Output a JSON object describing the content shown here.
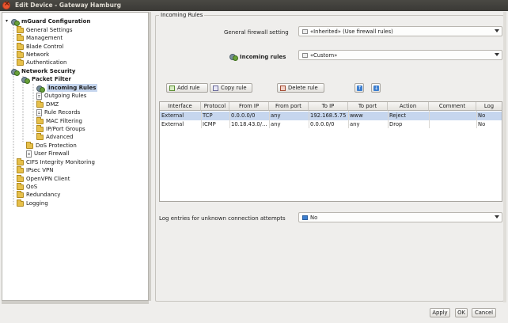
{
  "window": {
    "title": "Edit Device - Gateway Hamburg"
  },
  "tree": {
    "items": [
      {
        "label": "mGuard Configuration",
        "bold": true
      },
      {
        "label": "General Settings"
      },
      {
        "label": "Management"
      },
      {
        "label": "Blade Control"
      },
      {
        "label": "Network"
      },
      {
        "label": "Authentication"
      },
      {
        "label": "Network Security",
        "bold": true
      },
      {
        "label": "Packet Filter",
        "bold": true
      },
      {
        "label": "Incoming Rules",
        "bold": true,
        "selected": true
      },
      {
        "label": "Outgoing Rules"
      },
      {
        "label": "DMZ"
      },
      {
        "label": "Rule Records"
      },
      {
        "label": "MAC Filtering"
      },
      {
        "label": "IP/Port Groups"
      },
      {
        "label": "Advanced"
      },
      {
        "label": "DoS Protection"
      },
      {
        "label": "User Firewall"
      },
      {
        "label": "CIFS Integrity Monitoring"
      },
      {
        "label": "IPsec VPN"
      },
      {
        "label": "OpenVPN Client"
      },
      {
        "label": "QoS"
      },
      {
        "label": "Redundancy"
      },
      {
        "label": "Logging"
      }
    ]
  },
  "group": {
    "title": "Incoming Rules"
  },
  "fields": {
    "general_firewall_label": "General firewall setting",
    "general_firewall_value": "«Inherited» (Use firewall rules)",
    "incoming_rules_label": "Incoming rules",
    "incoming_rules_value": "«Custom»",
    "log_label": "Log entries for unknown connection attempts",
    "log_value": "No"
  },
  "toolbar": {
    "add_rule": "Add rule",
    "copy_rule": "Copy rule",
    "delete_rule": "Delete rule",
    "move_up": "↑",
    "move_down": "↓"
  },
  "table": {
    "headers": [
      "Interface",
      "Protocol",
      "From IP",
      "From port",
      "To IP",
      "To port",
      "Action",
      "Comment",
      "Log"
    ],
    "rows": [
      {
        "interface": "External",
        "protocol": "TCP",
        "from_ip": "0.0.0.0/0",
        "from_port": "any",
        "to_ip": "192.168.5.75",
        "to_port": "www",
        "action": "Reject",
        "comment": "",
        "log": "No"
      },
      {
        "interface": "External",
        "protocol": "ICMP",
        "from_ip": "10.18.43.0/...",
        "from_port": "any",
        "to_ip": "0.0.0.0/0",
        "to_port": "any",
        "action": "Drop",
        "comment": "",
        "log": "No"
      }
    ]
  },
  "buttons": {
    "apply": "Apply",
    "ok": "OK",
    "cancel": "Cancel"
  }
}
